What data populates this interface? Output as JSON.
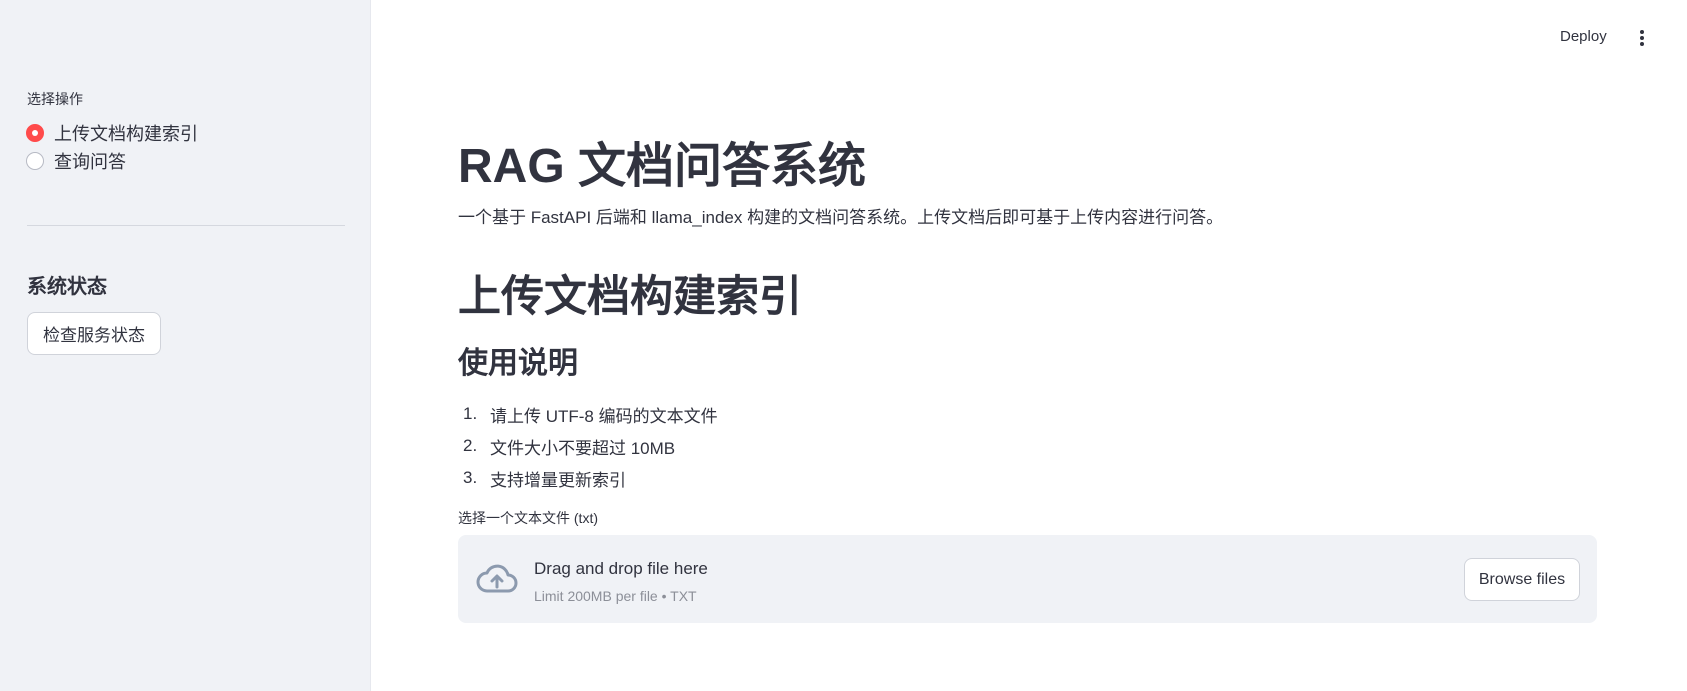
{
  "sidebar": {
    "radio_label": "选择操作",
    "options": [
      {
        "label": "上传文档构建索引",
        "selected": true
      },
      {
        "label": "查询问答",
        "selected": false
      }
    ],
    "status_heading": "系统状态",
    "check_button": "检查服务状态"
  },
  "header": {
    "deploy": "Deploy",
    "menu_icon": "more-vertical-icon"
  },
  "main": {
    "title": "RAG 文档问答系统",
    "subtitle": "一个基于 FastAPI 后端和 llama_index 构建的文档问答系统。上传文档后即可基于上传内容进行问答。",
    "section_title": "上传文档构建索引",
    "usage_title": "使用说明",
    "usage_items": [
      {
        "num": "1.",
        "text": "请上传 UTF-8 编码的文本文件"
      },
      {
        "num": "2.",
        "text": "文件大小不要超过 10MB"
      },
      {
        "num": "3.",
        "text": "支持增量更新索引"
      }
    ],
    "uploader": {
      "label": "选择一个文本文件 (txt)",
      "drop_text": "Drag and drop file here",
      "limit_text": "Limit 200MB per file • TXT",
      "browse_label": "Browse files",
      "icon": "cloud-upload-icon"
    }
  },
  "colors": {
    "accent": "#ff4b4b",
    "sidebar_bg": "#f0f2f6",
    "text": "#31333f"
  }
}
